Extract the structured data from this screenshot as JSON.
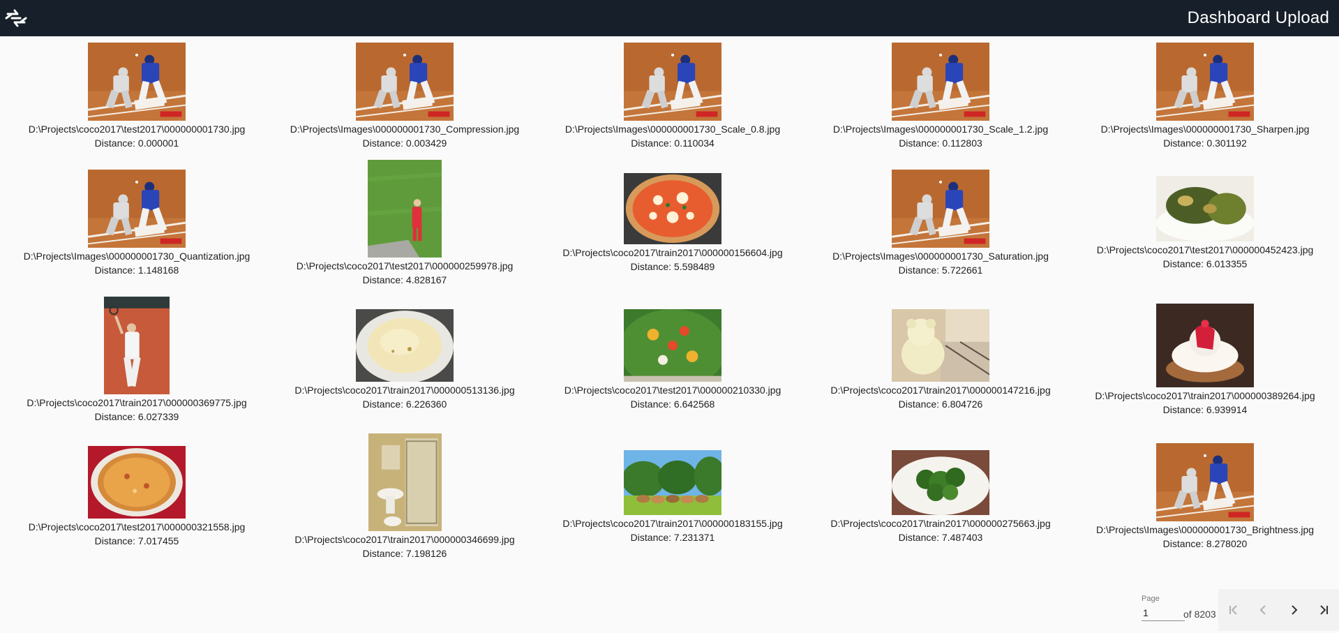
{
  "header": {
    "title": "Dashboard Upload",
    "logo_icon": "exchange-logo-icon"
  },
  "results": [
    {
      "path": "D:\\Projects\\coco2017\\test2017\\000000001730.jpg",
      "distance": "Distance: 0.000001",
      "scene": "baseball"
    },
    {
      "path": "D:\\Projects\\Images\\000000001730_Compression.jpg",
      "distance": "Distance: 0.003429",
      "scene": "baseball"
    },
    {
      "path": "D:\\Projects\\Images\\000000001730_Scale_0.8.jpg",
      "distance": "Distance: 0.110034",
      "scene": "baseball"
    },
    {
      "path": "D:\\Projects\\Images\\000000001730_Scale_1.2.jpg",
      "distance": "Distance: 0.112803",
      "scene": "baseball"
    },
    {
      "path": "D:\\Projects\\Images\\000000001730_Sharpen.jpg",
      "distance": "Distance: 0.301192",
      "scene": "baseball"
    },
    {
      "path": "D:\\Projects\\Images\\000000001730_Quantization.jpg",
      "distance": "Distance: 1.148168",
      "scene": "baseball"
    },
    {
      "path": "D:\\Projects\\coco2017\\test2017\\000000259978.jpg",
      "distance": "Distance: 4.828167",
      "scene": "grass"
    },
    {
      "path": "D:\\Projects\\coco2017\\train2017\\000000156604.jpg",
      "distance": "Distance: 5.598489",
      "scene": "pizza"
    },
    {
      "path": "D:\\Projects\\Images\\000000001730_Saturation.jpg",
      "distance": "Distance: 5.722661",
      "scene": "baseball"
    },
    {
      "path": "D:\\Projects\\coco2017\\test2017\\000000452423.jpg",
      "distance": "Distance: 6.013355",
      "scene": "greens"
    },
    {
      "path": "D:\\Projects\\coco2017\\train2017\\000000369775.jpg",
      "distance": "Distance: 6.027339",
      "scene": "tennis"
    },
    {
      "path": "D:\\Projects\\coco2017\\train2017\\000000513136.jpg",
      "distance": "Distance: 6.226360",
      "scene": "flatbread"
    },
    {
      "path": "D:\\Projects\\coco2017\\test2017\\000000210330.jpg",
      "distance": "Distance: 6.642568",
      "scene": "saladpizza"
    },
    {
      "path": "D:\\Projects\\coco2017\\train2017\\000000147216.jpg",
      "distance": "Distance: 6.804726",
      "scene": "teddy"
    },
    {
      "path": "D:\\Projects\\coco2017\\train2017\\000000389264.jpg",
      "distance": "Distance: 6.939914",
      "scene": "cake"
    },
    {
      "path": "D:\\Projects\\coco2017\\test2017\\000000321558.jpg",
      "distance": "Distance: 7.017455",
      "scene": "pizza2"
    },
    {
      "path": "D:\\Projects\\coco2017\\train2017\\000000346699.jpg",
      "distance": "Distance: 7.198126",
      "scene": "bathroom"
    },
    {
      "path": "D:\\Projects\\coco2017\\train2017\\000000183155.jpg",
      "distance": "Distance: 7.231371",
      "scene": "horses"
    },
    {
      "path": "D:\\Projects\\coco2017\\train2017\\000000275663.jpg",
      "distance": "Distance: 7.487403",
      "scene": "broccoli"
    },
    {
      "path": "D:\\Projects\\Images\\000000001730_Brightness.jpg",
      "distance": "Distance: 8.278020",
      "scene": "baseball"
    }
  ],
  "pagination": {
    "page_label": "Page",
    "page_value": "1",
    "of_text": "of 8203",
    "first_icon": "first-page-icon",
    "prev_icon": "chevron-left-icon",
    "next_icon": "chevron-right-icon",
    "last_icon": "last-page-icon"
  }
}
